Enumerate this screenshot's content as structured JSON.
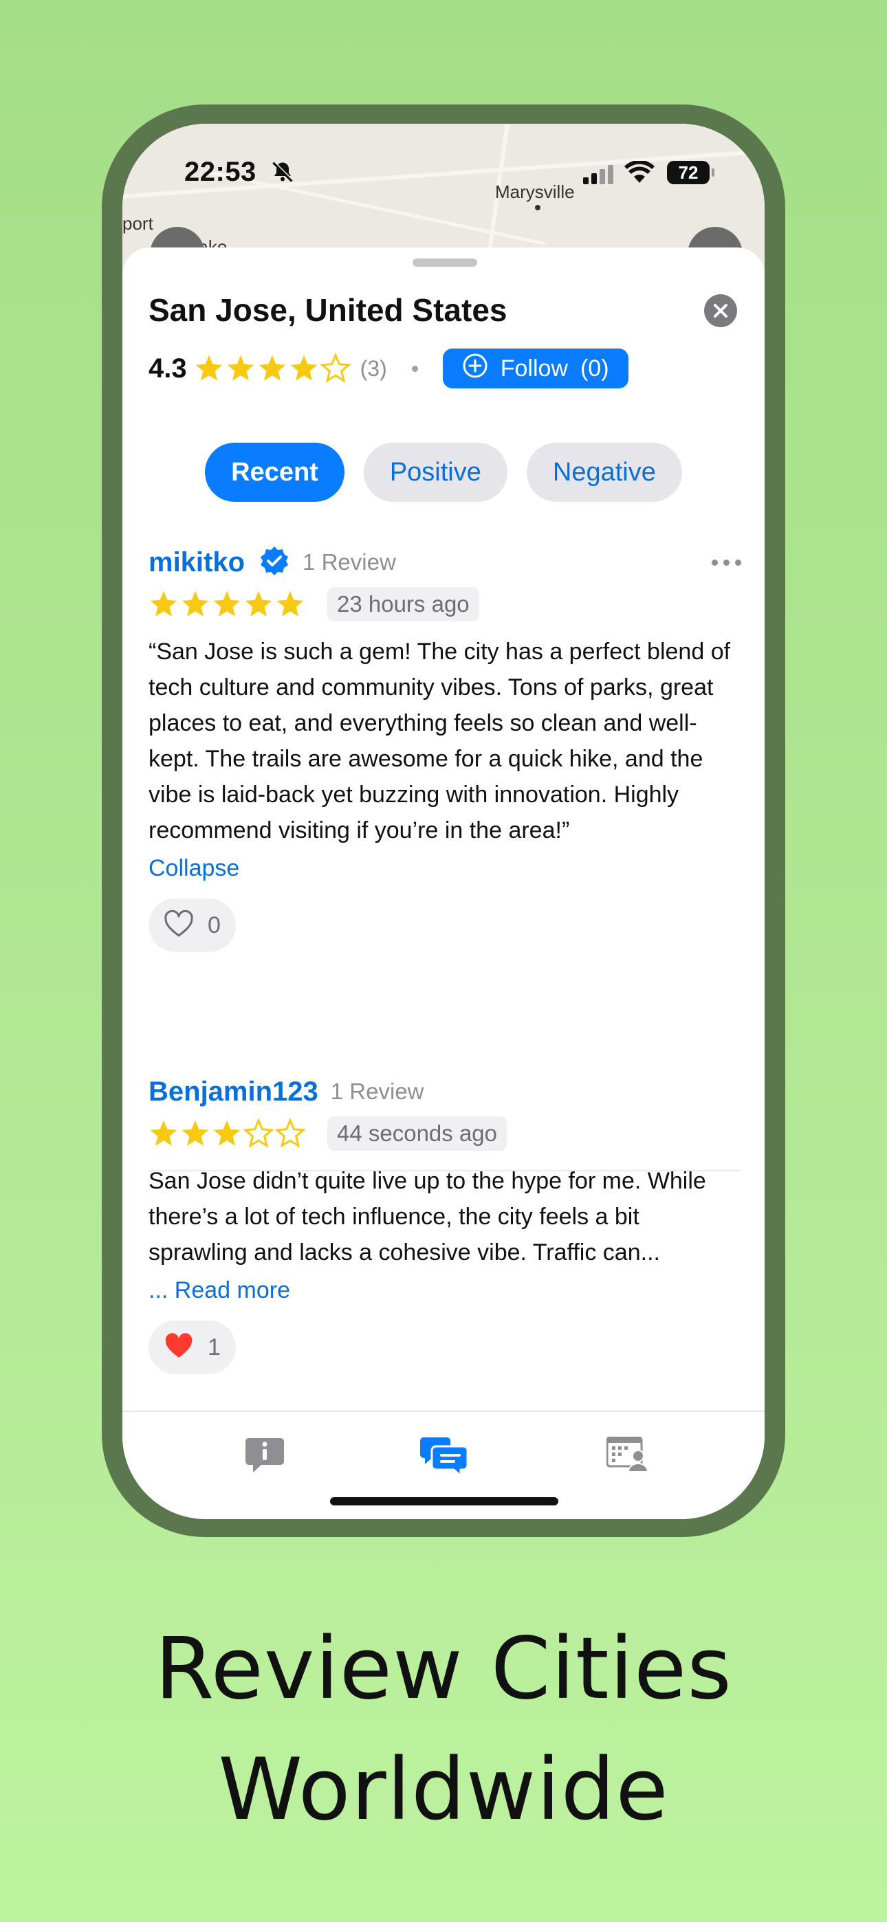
{
  "colors": {
    "accent": "#0a7cff",
    "star": "#f7c911",
    "heart": "#ff3b30",
    "background": "#b4e896"
  },
  "status_bar": {
    "time": "22:53",
    "battery": "72"
  },
  "map": {
    "place_main": "Marysville",
    "place_left_1": "port",
    "place_left_2": "rlake"
  },
  "sheet": {
    "title": "San Jose, United States",
    "rating": "4.3",
    "rating_stars": 4.3,
    "rating_count": "(3)",
    "follow_label": "Follow",
    "follow_count": "(0)"
  },
  "tabs": [
    {
      "label": "Recent",
      "active": true
    },
    {
      "label": "Positive",
      "active": false
    },
    {
      "label": "Negative",
      "active": false
    }
  ],
  "reviews": [
    {
      "username": "mikitko",
      "verified": true,
      "review_count": "1 Review",
      "stars": 5,
      "time": "23 hours ago",
      "text": "“San Jose is such a gem! The city has a perfect blend of tech culture and community vibes. Tons of parks, great places to eat, and everything feels so clean and well-kept. The trails are awesome for a quick hike, and the vibe is laid-back yet buzzing with innovation. Highly recommend visiting if you’re in the area!”",
      "link": "Collapse",
      "likes": "0",
      "liked": false
    },
    {
      "username": "Benjamin123",
      "verified": false,
      "review_count": "1 Review",
      "stars": 3,
      "time": "44 seconds ago",
      "text": "San Jose didn’t quite live up to the hype for me. While there’s a lot of tech influence, the city feels a bit sprawling and lacks a cohesive vibe. Traffic can...",
      "link": "... Read more",
      "likes": "1",
      "liked": true
    }
  ],
  "tab_bar": [
    "info-icon",
    "reviews-icon",
    "people-icon"
  ],
  "headline": {
    "line1": "Review Cities",
    "line2": "Worldwide"
  }
}
